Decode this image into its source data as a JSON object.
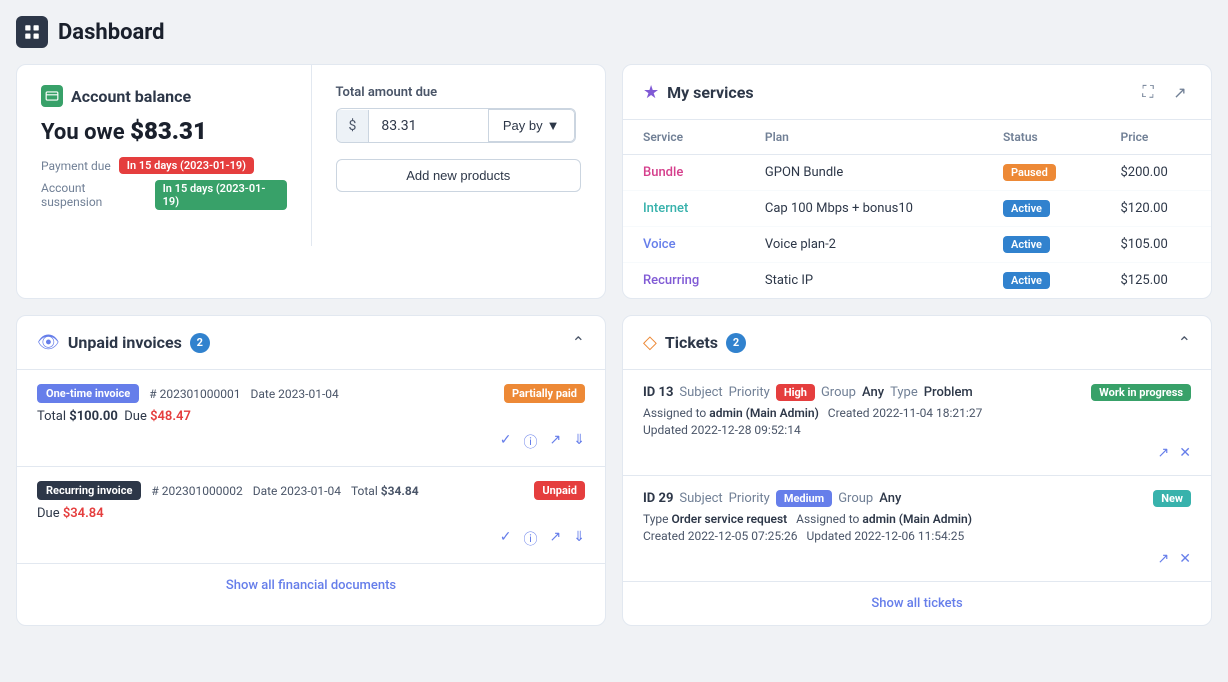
{
  "header": {
    "title": "Dashboard",
    "icon": "grid-icon"
  },
  "account_balance": {
    "title": "Account balance",
    "subtitle": "You owe",
    "amount": "$83.31",
    "payment_due_label": "Payment due",
    "payment_due_badge": "In 15 days (2023-01-19)",
    "suspension_label": "Account suspension",
    "suspension_badge": "In 15 days (2023-01-19)",
    "total_due_label": "Total amount due",
    "amount_value": "83.31",
    "amount_prefix": "$",
    "pay_by_label": "Pay by",
    "add_products_label": "Add new products"
  },
  "services": {
    "title": "My services",
    "columns": [
      "Service",
      "Plan",
      "Status",
      "Price"
    ],
    "rows": [
      {
        "service": "Bundle",
        "plan": "GPON Bundle",
        "status": "Paused",
        "price": "$200.00",
        "link_color": "pink"
      },
      {
        "service": "Internet",
        "plan": "Cap 100 Mbps + bonus10",
        "status": "Active",
        "price": "$120.00",
        "link_color": "teal"
      },
      {
        "service": "Voice",
        "plan": "Voice plan-2",
        "status": "Active",
        "price": "$105.00",
        "link_color": "blue"
      },
      {
        "service": "Recurring",
        "plan": "Static IP",
        "status": "Active",
        "price": "$125.00",
        "link_color": "purple"
      }
    ]
  },
  "invoices": {
    "title": "Unpaid invoices",
    "count": "2",
    "items": [
      {
        "type": "One-time invoice",
        "type_class": "badge-onetime",
        "number": "202301000001",
        "date": "2023-01-04",
        "total": "$100.00",
        "due": "$48.47",
        "status": "Partially paid",
        "status_class": "badge-partially-paid"
      },
      {
        "type": "Recurring invoice",
        "type_class": "badge-recurring",
        "number": "202301000002",
        "date": "2023-01-04",
        "total": "$34.84",
        "due": "$34.84",
        "status": "Unpaid",
        "status_class": "badge-unpaid"
      }
    ],
    "show_all_label": "Show all financial documents"
  },
  "tickets": {
    "title": "Tickets",
    "count": "2",
    "items": [
      {
        "id": "13",
        "subject_label": "Subject",
        "priority_label": "Priority",
        "priority": "High",
        "priority_class": "priority-high",
        "group_label": "Group",
        "group": "Any",
        "type_label": "Type",
        "type_value": "Problem",
        "status": "Work in progress",
        "status_class": "badge-wip",
        "assigned_label": "Assigned to",
        "assigned": "admin (Main Admin)",
        "created_label": "Created",
        "created": "2022-11-04 18:21:27",
        "updated_label": "Updated",
        "updated": "2022-12-28 09:52:14"
      },
      {
        "id": "29",
        "subject_label": "Subject",
        "priority_label": "Priority",
        "priority": "Medium",
        "priority_class": "priority-medium",
        "group_label": "Group",
        "group": "Any",
        "type_label": "Type",
        "type_value": "Order service request",
        "status": "New",
        "status_class": "badge-new",
        "assigned_label": "Assigned to",
        "assigned": "admin (Main Admin)",
        "created_label": "Created",
        "created": "2022-12-05 07:25:26",
        "updated_label": "Updated",
        "updated": "2022-12-06 11:54:25"
      }
    ],
    "show_all_label": "Show all tickets"
  }
}
